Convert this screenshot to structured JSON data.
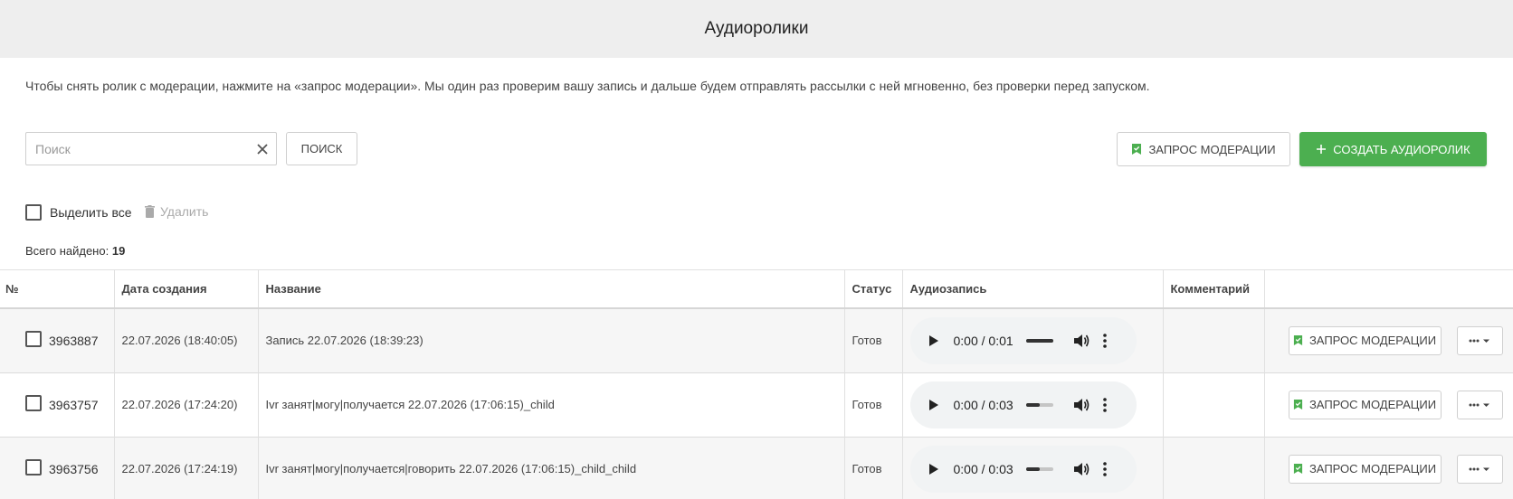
{
  "header": {
    "title": "Аудиоролики"
  },
  "info_text": "Чтобы снять ролик с модерации, нажмите на «запрос модерации». Мы один раз проверим вашу запись и дальше будем отправлять рассылки с ней мгновенно, без проверки перед запуском.",
  "search": {
    "placeholder": "Поиск",
    "value": "",
    "button_label": "ПОИСК"
  },
  "toolbar": {
    "moderation_label": "ЗАПРОС МОДЕРАЦИИ",
    "create_label": "СОЗДАТЬ АУДИОРОЛИК",
    "select_all_label": "Выделить все",
    "delete_label": "Удалить"
  },
  "total": {
    "label": "Всего найдено:",
    "count": "19"
  },
  "table": {
    "headers": {
      "num": "№",
      "created": "Дата создания",
      "name": "Название",
      "status": "Статус",
      "audio": "Аудиозапись",
      "comment": "Комментарий",
      "actions": ""
    },
    "rows": [
      {
        "id": "3963887",
        "created": "22.07.2026 (18:40:05)",
        "name": "Запись 22.07.2026 (18:39:23)",
        "status": "Готов",
        "audio_time": "0:00 / 0:01",
        "audio_progress": 1.0,
        "comment": "",
        "action_label": "ЗАПРОС МОДЕРАЦИИ"
      },
      {
        "id": "3963757",
        "created": "22.07.2026 (17:24:20)",
        "name": "Ivr занят|могу|получается 22.07.2026 (17:06:15)_child",
        "status": "Готов",
        "audio_time": "0:00 / 0:03",
        "audio_progress": 0.5,
        "comment": "",
        "action_label": "ЗАПРОС МОДЕРАЦИИ"
      },
      {
        "id": "3963756",
        "created": "22.07.2026 (17:24:19)",
        "name": "Ivr занят|могу|получается|говорить 22.07.2026 (17:06:15)_child_child",
        "status": "Готов",
        "audio_time": "0:00 / 0:03",
        "audio_progress": 0.5,
        "comment": "",
        "action_label": "ЗАПРОС МОДЕРАЦИИ"
      }
    ]
  },
  "icons": {
    "clear": "close-icon",
    "moderation": "bookmark-check-icon",
    "create": "plus-icon",
    "delete": "trash-icon",
    "play": "play-icon",
    "volume": "volume-icon",
    "more": "more-vert-icon",
    "menu": "more-horiz-icon"
  },
  "colors": {
    "accent_green": "#4caf50",
    "header_bg": "#eeeeee",
    "row_alt_bg": "#f6f6f6"
  }
}
